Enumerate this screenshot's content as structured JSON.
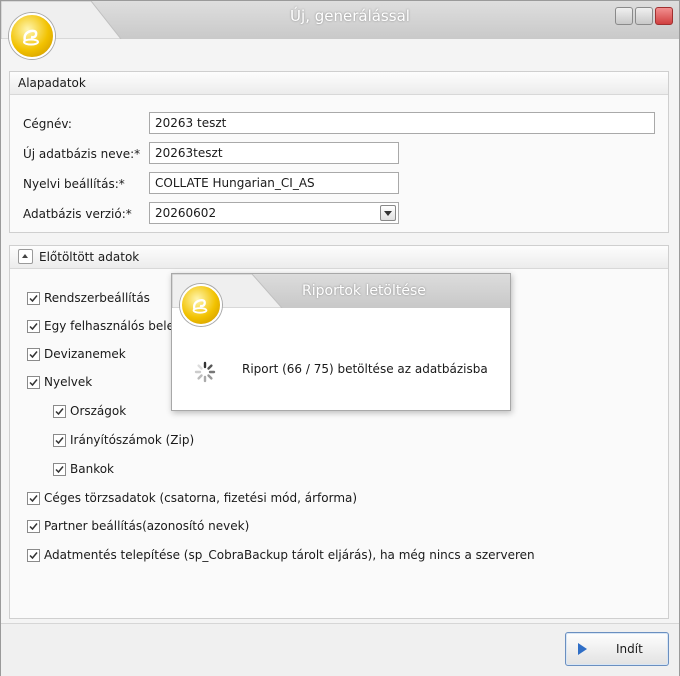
{
  "window": {
    "title": "Új, generálással"
  },
  "basic": {
    "header": "Alapadatok",
    "company_label": "Cégnév:",
    "company_value": "20263 teszt",
    "dbname_label": "Új adatbázis neve:*",
    "dbname_value": "20263teszt",
    "lang_label": "Nyelvi beállítás:*",
    "lang_value": "COLLATE Hungarian_CI_AS",
    "version_label": "Adatbázis verzió:*",
    "version_value": "20260602"
  },
  "preloaded": {
    "header": "Előtöltött adatok",
    "items": [
      {
        "label": "Rendszerbeállítás",
        "checked": true
      },
      {
        "label": "Egy felhasználós bele",
        "checked": true
      },
      {
        "label": "Devizanemek",
        "checked": true
      },
      {
        "label": "Nyelvek",
        "checked": true
      },
      {
        "label": "Országok",
        "checked": true
      },
      {
        "label": "Irányítószámok (Zip)",
        "checked": true
      },
      {
        "label": "Bankok",
        "checked": true
      },
      {
        "label": "Céges törzsadatok (csatorna, fizetési mód, árforma)",
        "checked": true
      },
      {
        "label": "Partner beállítás(azonosító nevek)",
        "checked": true
      },
      {
        "label": "Adatmentés telepítése (sp_CobraBackup tárolt eljárás), ha még nincs a szerveren",
        "checked": true
      }
    ]
  },
  "start_button": {
    "label": "Indít"
  },
  "popup": {
    "title": "Riportok letöltése",
    "message": "Riport (66 / 75) betöltése az adatbázisba"
  },
  "colors": {
    "accent": "#2f6ec6",
    "logo": "#f2c200",
    "close": "#d04040"
  }
}
